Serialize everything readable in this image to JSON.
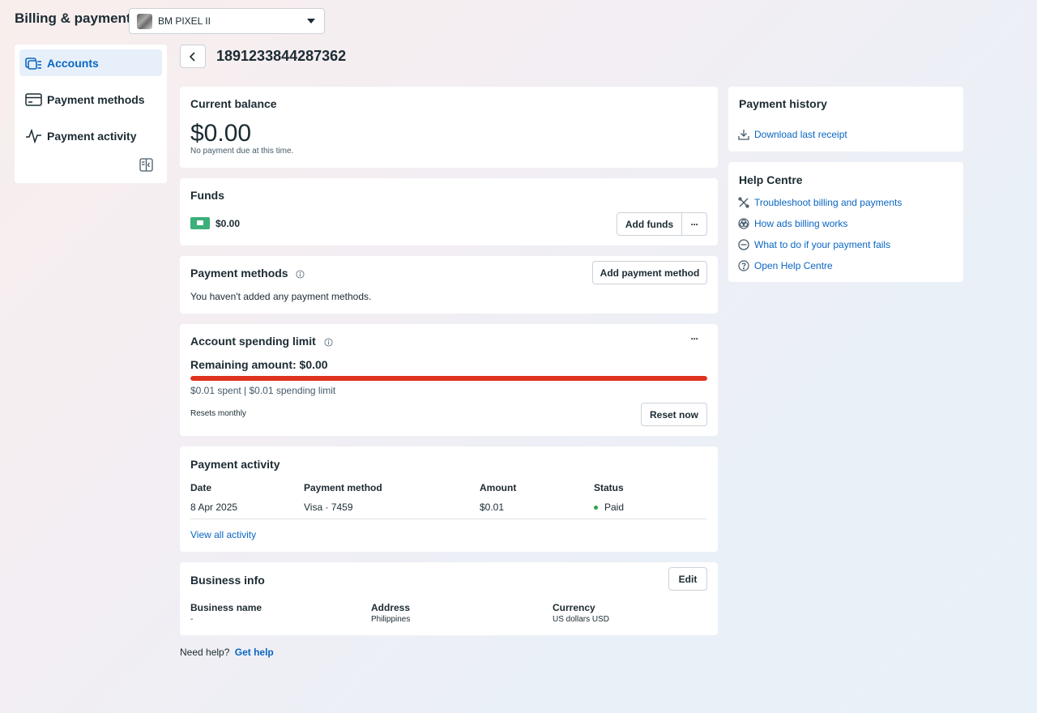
{
  "header": {
    "title": "Billing & payments",
    "account_selector": {
      "value": "BM PIXEL II"
    }
  },
  "sidebar": {
    "items": [
      {
        "label": "Accounts",
        "icon": "accounts-icon",
        "active": true
      },
      {
        "label": "Payment methods",
        "icon": "credit-card-icon",
        "active": false
      },
      {
        "label": "Payment activity",
        "icon": "activity-pulse-icon",
        "active": false
      }
    ],
    "collapse_icon": "collapse-panel-icon"
  },
  "main": {
    "account_id": "1891233844287362",
    "current_balance": {
      "title": "Current balance",
      "amount": "$0.00",
      "note": "No payment due at this time."
    },
    "funds": {
      "title": "Funds",
      "amount": "$0.00",
      "add_funds_label": "Add funds",
      "more_label": "···"
    },
    "payment_methods": {
      "title": "Payment methods",
      "add_label": "Add payment method",
      "empty_text": "You haven't added any payment methods."
    },
    "spending_limit": {
      "title": "Account spending limit",
      "remaining": "Remaining amount: $0.00",
      "progress_fraction": 1.0,
      "summary": "$0.01 spent | $0.01 spending limit",
      "resets": "Resets monthly",
      "reset_label": "Reset now",
      "more_label": "···"
    },
    "payment_activity": {
      "title": "Payment activity",
      "columns": [
        "Date",
        "Payment method",
        "Amount",
        "Status"
      ],
      "rows": [
        {
          "date": "8 Apr 2025",
          "method": "Visa · 7459",
          "amount": "$0.01",
          "status": "Paid"
        }
      ],
      "view_all_label": "View all activity"
    },
    "business_info": {
      "title": "Business info",
      "edit_label": "Edit",
      "fields": [
        {
          "label": "Business name",
          "value": "-"
        },
        {
          "label": "Address",
          "value": "Philippines"
        },
        {
          "label": "Currency",
          "value": "US dollars USD"
        }
      ]
    },
    "need_help": {
      "text": "Need help?",
      "link": "Get help"
    }
  },
  "right": {
    "payment_history": {
      "title": "Payment history",
      "download_label": "Download last receipt"
    },
    "help_centre": {
      "title": "Help Centre",
      "links": [
        {
          "label": "Troubleshoot billing and payments",
          "icon": "tools-icon"
        },
        {
          "label": "How ads billing works",
          "icon": "billing-circles-icon"
        },
        {
          "label": "What to do if your payment fails",
          "icon": "minus-circle-icon"
        },
        {
          "label": "Open Help Centre",
          "icon": "question-circle-icon"
        }
      ]
    }
  },
  "colors": {
    "accent": "#0a66c2",
    "danger": "#e0331e",
    "success": "#31a24c",
    "funds_badge": "#3bb07a"
  }
}
